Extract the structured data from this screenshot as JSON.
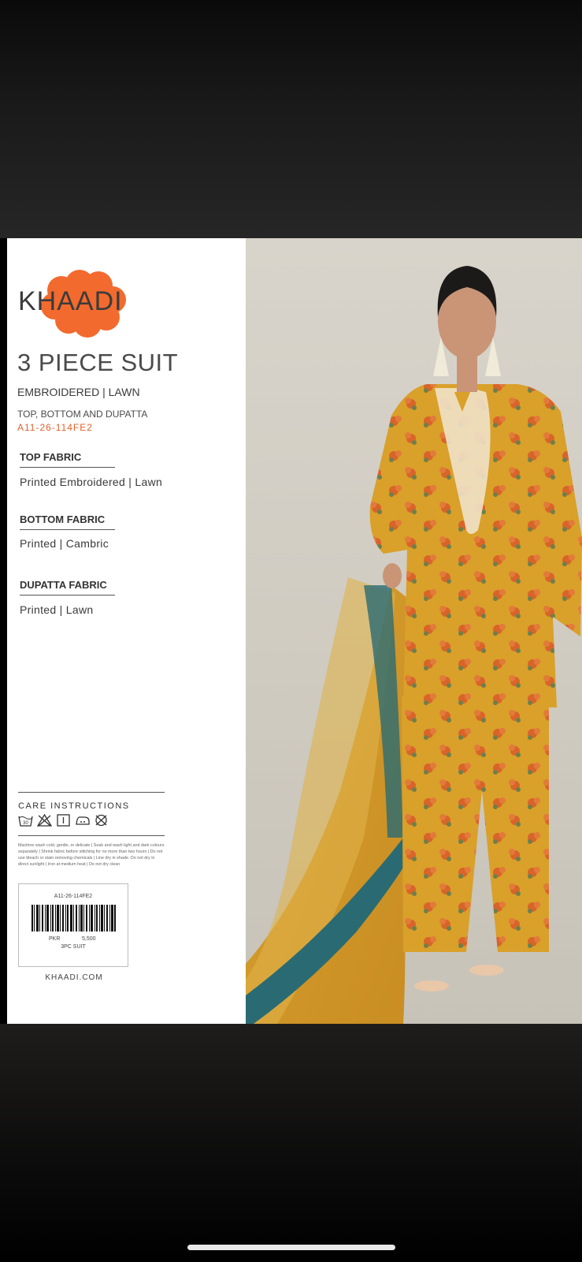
{
  "brand": {
    "logo_text": "KHAADI",
    "accent": "#f26a2e"
  },
  "product": {
    "title": "3 PIECE SUIT",
    "subtitle": "EMBROIDERED | LAWN",
    "components": "TOP, BOTTOM AND DUPATTA",
    "code": "A11-26-114FE2"
  },
  "fabrics": [
    {
      "heading": "TOP FABRIC",
      "value": "Printed Embroidered | Lawn"
    },
    {
      "heading": "BOTTOM FABRIC",
      "value": "Printed | Cambric"
    },
    {
      "heading": "DUPATTA FABRIC",
      "value": "Printed | Lawn"
    }
  ],
  "care": {
    "title": "CARE INSTRUCTIONS",
    "icons": [
      "wash-30-icon",
      "no-bleach-icon",
      "line-dry-icon",
      "iron-low-icon",
      "no-dry-clean-icon"
    ],
    "text": "Machine wash cold, gentle, or delicate | Soak and wash light and dark colours separately | Shrink fabric before stitching for no more than two hours | Do not use bleach or stain removing chemicals | Line dry in shade. Do not dry in direct sunlight | Iron at medium heat | Do not dry clean"
  },
  "tag": {
    "code": "A11-26-114FE2",
    "currency": "PKR",
    "price": "5,500",
    "type": "3PC SUIT"
  },
  "website": "KHAADI.COM"
}
